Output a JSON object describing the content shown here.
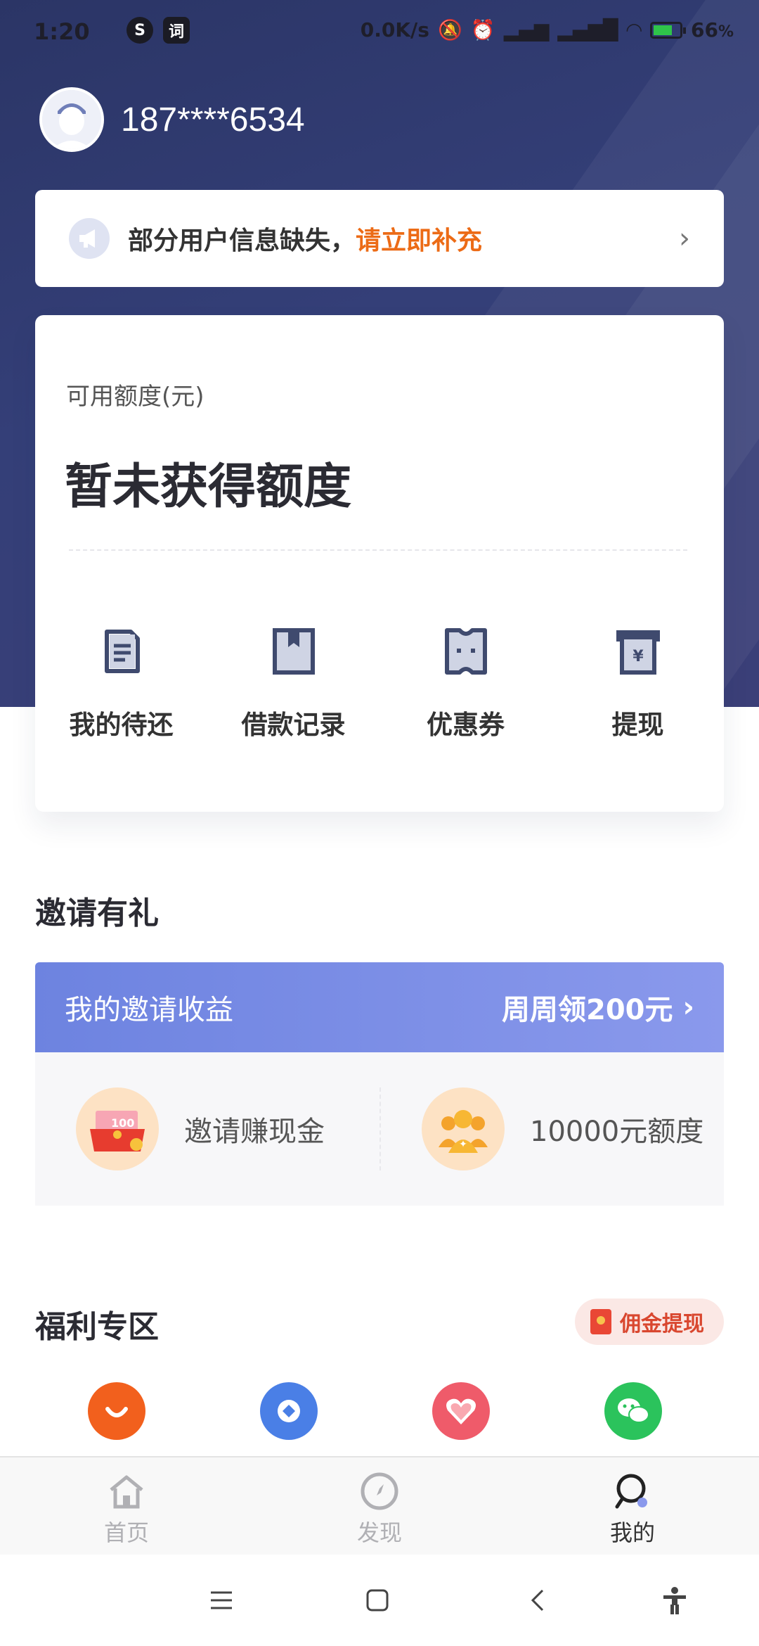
{
  "status_bar": {
    "time": "1:20",
    "net_speed": "0.0K/s",
    "battery": "66",
    "battery_unit": "%",
    "battery_level": 0.66,
    "icons": [
      "sogou-icon",
      "dictionary-icon",
      "mute-icon",
      "alarm-icon",
      "hd-signal-icon",
      "hd-signal-icon",
      "wifi-icon",
      "battery-charging-icon"
    ]
  },
  "profile": {
    "phone": "187****6534"
  },
  "notice": {
    "text": "部分用户信息缺失，",
    "link": "请立即补充"
  },
  "credit": {
    "label": "可用额度(元)",
    "amount": "暂未获得额度",
    "shortcuts": [
      {
        "label": "我的待还",
        "icon": "repayment-doc-icon"
      },
      {
        "label": "借款记录",
        "icon": "loan-record-icon"
      },
      {
        "label": "优惠券",
        "icon": "coupon-icon"
      },
      {
        "label": "提现",
        "icon": "withdraw-icon"
      }
    ]
  },
  "invite": {
    "section_title": "邀请有礼",
    "banner_title": "我的邀请收益",
    "banner_cta": "周周领200元",
    "items": [
      {
        "label": "邀请赚现金",
        "icon": "red-envelope-icon"
      },
      {
        "label": "10000元额度",
        "icon": "group-users-icon"
      }
    ]
  },
  "welfare": {
    "section_title": "福利专区",
    "commission_label": "佣金提现",
    "apps": [
      {
        "icon": "taobao-icon",
        "color": "#f2601d"
      },
      {
        "icon": "blue-diamond-icon",
        "color": "#4a7fe6"
      },
      {
        "icon": "heart-icon",
        "color": "#ef5b6a"
      },
      {
        "icon": "wechat-icon",
        "color": "#2bc35c"
      }
    ]
  },
  "tabbar": {
    "tabs": [
      {
        "label": "首页",
        "icon": "home-icon"
      },
      {
        "label": "发现",
        "icon": "compass-icon"
      },
      {
        "label": "我的",
        "icon": "profile-search-icon",
        "active": true
      }
    ]
  },
  "colors": {
    "hero": "#2f3a6e",
    "accent_orange": "#ec6b16",
    "banner_blue": "#6d83e0"
  }
}
